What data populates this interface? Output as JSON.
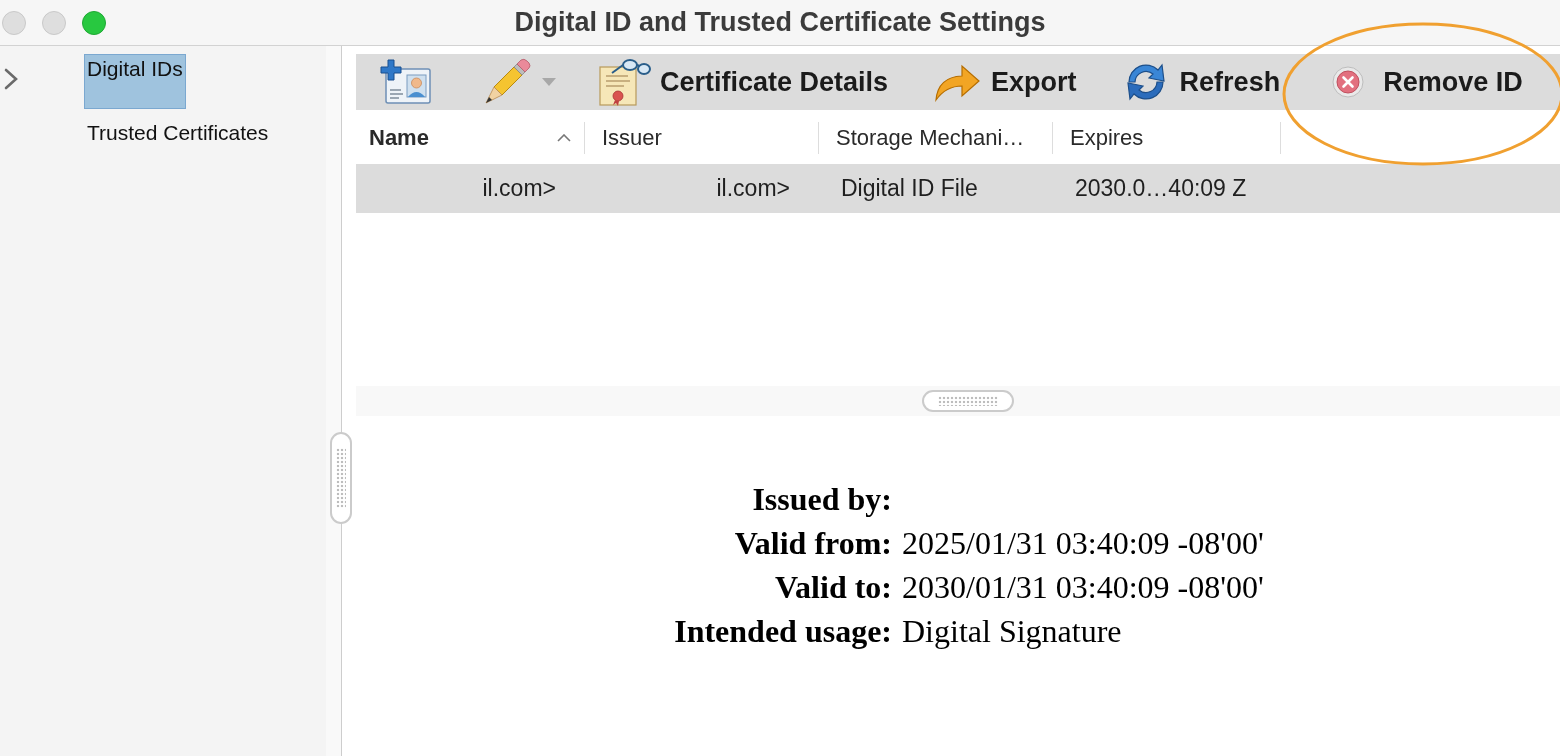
{
  "window": {
    "title": "Digital ID and Trusted Certificate Settings",
    "controls": [
      {
        "kind": "close",
        "enabled": false
      },
      {
        "kind": "minimize",
        "enabled": false
      },
      {
        "kind": "zoom",
        "enabled": true
      }
    ]
  },
  "sidebar": {
    "items": [
      {
        "label": "Digital IDs",
        "selected": true
      },
      {
        "label": "Trusted Certificates",
        "selected": false
      }
    ]
  },
  "toolbar": {
    "items": [
      {
        "kind": "add",
        "highlighted": false
      },
      {
        "kind": "edit",
        "highlighted": false
      },
      {
        "kind": "details",
        "label": "Certificate Details",
        "highlighted": false
      },
      {
        "kind": "export",
        "label": "Export",
        "highlighted": false
      },
      {
        "kind": "refresh",
        "label": "Refresh",
        "highlighted": false
      },
      {
        "kind": "remove",
        "label": "Remove ID",
        "highlighted": true
      }
    ]
  },
  "table": {
    "columns": [
      {
        "label": "Name",
        "sorted": true
      },
      {
        "label": "Issuer",
        "sorted": false
      },
      {
        "label": "Storage Mechani…",
        "sorted": false
      },
      {
        "label": "Expires",
        "sorted": false
      }
    ],
    "rows": [
      {
        "selected": true,
        "cells": [
          "il.com>",
          "il.com>",
          "Digital ID File",
          "2030.0…40:09 Z"
        ]
      }
    ]
  },
  "details": {
    "fields": [
      {
        "label": "Issued by:"
      },
      {
        "label": "Valid from:",
        "value": "2025/01/31 03:40:09 -08'00'"
      },
      {
        "label": "Valid to:",
        "value": "2030/01/31 03:40:09 -08'00'"
      },
      {
        "label": "Intended usage:",
        "value": "Digital Signature"
      }
    ]
  }
}
